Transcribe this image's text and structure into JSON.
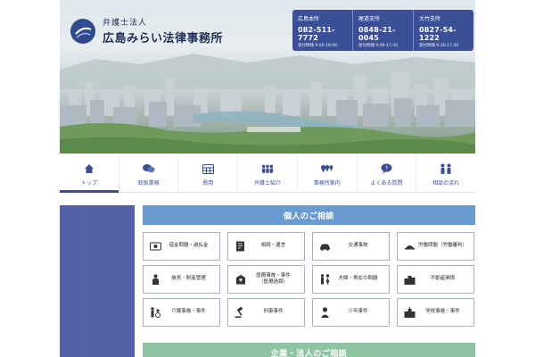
{
  "logo": {
    "subtitle": "弁護士法人",
    "name": "広島みらい法律事務所"
  },
  "offices": [
    {
      "name": "広島本所",
      "phone": "082-511-7772",
      "hours": "受付時間 9:00-18:00"
    },
    {
      "name": "尾道支所",
      "phone": "0848-21-0045",
      "hours": "受付時間 9:00-17:30"
    },
    {
      "name": "大竹支所",
      "phone": "0827-54-1222",
      "hours": "受付時間 9:30-17:30"
    }
  ],
  "nav": [
    {
      "label": "トップ",
      "icon": "home-icon"
    },
    {
      "label": "取扱業務",
      "icon": "chat-icon"
    },
    {
      "label": "費用",
      "icon": "calculator-icon"
    },
    {
      "label": "弁護士紹介",
      "icon": "people-icon"
    },
    {
      "label": "事務所案内",
      "icon": "map-pin-icon"
    },
    {
      "label": "よくある質問",
      "icon": "question-bubble-icon"
    },
    {
      "label": "相談の流れ",
      "icon": "consultation-icon"
    }
  ],
  "sections": {
    "individual": "個人のご相談",
    "corporate": "企業・法人のご相談"
  },
  "consultations": [
    {
      "label": "借金問題・過払金",
      "icon": "money-icon"
    },
    {
      "label": "相続・遺言",
      "icon": "document-icon"
    },
    {
      "label": "交通事故",
      "icon": "car-icon"
    },
    {
      "label": "労働問題（労働審判）",
      "icon": "worker-icon"
    },
    {
      "label": "後見・財産管理",
      "icon": "guardian-icon"
    },
    {
      "label": "医療事故・事件\n（医療過誤）",
      "icon": "hospital-icon"
    },
    {
      "label": "夫婦・男女の問題",
      "icon": "couple-icon"
    },
    {
      "label": "不動産関係",
      "icon": "buildings-icon"
    },
    {
      "label": "介護事故・事件",
      "icon": "caregiver-icon"
    },
    {
      "label": "刑事事件",
      "icon": "gavel-icon"
    },
    {
      "label": "少年事件",
      "icon": "youth-icon"
    },
    {
      "label": "学校事故・事件",
      "icon": "school-icon"
    }
  ],
  "colors": {
    "brand": "#3a4f98",
    "individual_header": "#6a9bd0",
    "corporate_header": "#8fc4a0",
    "sidebar": "#5461a8"
  }
}
